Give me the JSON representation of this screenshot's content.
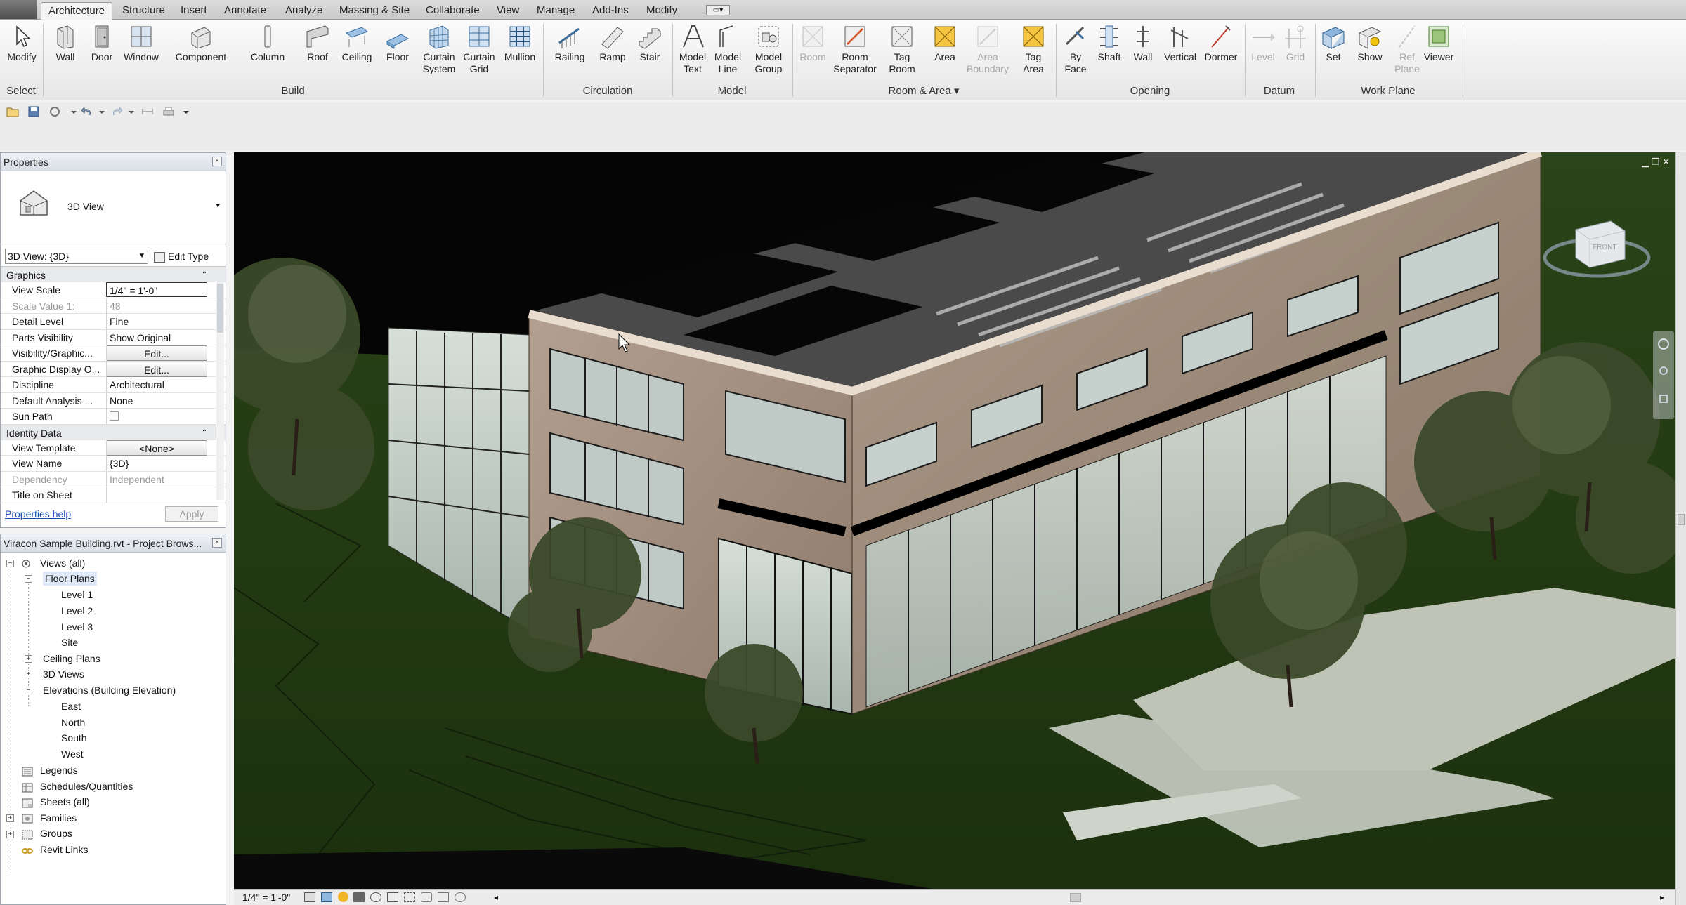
{
  "tabs": [
    "Architecture",
    "Structure",
    "Insert",
    "Annotate",
    "Analyze",
    "Massing & Site",
    "Collaborate",
    "View",
    "Manage",
    "Add-Ins",
    "Modify"
  ],
  "ribbon": {
    "select": {
      "modify": "Modify",
      "panel": "Select"
    },
    "build": {
      "wall": "Wall",
      "door": "Door",
      "window": "Window",
      "component": "Component",
      "column": "Column",
      "roof": "Roof",
      "ceiling": "Ceiling",
      "floor": "Floor",
      "curtain_system": [
        "Curtain",
        "System"
      ],
      "curtain_grid": [
        "Curtain",
        "Grid"
      ],
      "mullion": "Mullion",
      "panel": "Build"
    },
    "circulation": {
      "railing": "Railing",
      "ramp": "Ramp",
      "stair": "Stair",
      "panel": "Circulation"
    },
    "model": {
      "model_text": [
        "Model",
        "Text"
      ],
      "model_line": [
        "Model",
        "Line"
      ],
      "model_group": [
        "Model",
        "Group"
      ],
      "panel": "Model"
    },
    "room_area": {
      "room": "Room",
      "room_separator": [
        "Room",
        "Separator"
      ],
      "tag_room": [
        "Tag",
        "Room"
      ],
      "area": "Area",
      "area_boundary": [
        "Area",
        "Boundary"
      ],
      "tag_area": [
        "Tag",
        "Area"
      ],
      "panel": "Room & Area"
    },
    "opening": {
      "by_face": [
        "By",
        "Face"
      ],
      "shaft": "Shaft",
      "wall": "Wall",
      "vertical": "Vertical",
      "dormer": "Dormer",
      "panel": "Opening"
    },
    "datum": {
      "level": "Level",
      "grid": "Grid",
      "panel": "Datum"
    },
    "work_plane": {
      "set": "Set",
      "show": "Show",
      "ref_plane": [
        "Ref",
        "Plane"
      ],
      "viewer": "Viewer",
      "panel": "Work Plane"
    }
  },
  "properties": {
    "title": "Properties",
    "type_name": "3D View",
    "instance_selector": "3D View: {3D}",
    "edit_type": "Edit Type",
    "groups": {
      "graphics": "Graphics",
      "identity": "Identity Data"
    },
    "rows": {
      "view_scale": {
        "k": "View Scale",
        "v": "1/4\" = 1'-0\""
      },
      "scale_value": {
        "k": "Scale Value    1:",
        "v": "48"
      },
      "detail_level": {
        "k": "Detail Level",
        "v": "Fine"
      },
      "parts_visibility": {
        "k": "Parts Visibility",
        "v": "Show Original"
      },
      "visibility_graphics": {
        "k": "Visibility/Graphic...",
        "v": "Edit..."
      },
      "graphic_display": {
        "k": "Graphic Display O...",
        "v": "Edit..."
      },
      "discipline": {
        "k": "Discipline",
        "v": "Architectural"
      },
      "default_analysis": {
        "k": "Default Analysis ...",
        "v": "None"
      },
      "sun_path": {
        "k": "Sun Path",
        "v": ""
      },
      "view_template": {
        "k": "View Template",
        "v": "<None>"
      },
      "view_name": {
        "k": "View Name",
        "v": "{3D}"
      },
      "dependency": {
        "k": "Dependency",
        "v": "Independent"
      },
      "title_on_sheet": {
        "k": "Title on Sheet",
        "v": ""
      }
    },
    "help": "Properties help",
    "apply": "Apply"
  },
  "browser": {
    "title": "Viracon Sample Building.rvt - Project Brows...",
    "nodes": {
      "views_all": "Views (all)",
      "floor_plans": "Floor Plans",
      "level1": "Level 1",
      "level2": "Level 2",
      "level3": "Level 3",
      "site": "Site",
      "ceiling_plans": "Ceiling Plans",
      "views3d": "3D Views",
      "elevations": "Elevations (Building Elevation)",
      "east": "East",
      "north": "North",
      "south": "South",
      "west": "West",
      "legends": "Legends",
      "schedules": "Schedules/Quantities",
      "sheets": "Sheets (all)",
      "families": "Families",
      "groups": "Groups",
      "revit_links": "Revit Links"
    }
  },
  "viewport": {
    "viewcube_face": "FRONT"
  },
  "status": {
    "scale": "1/4\" = 1'-0\""
  }
}
